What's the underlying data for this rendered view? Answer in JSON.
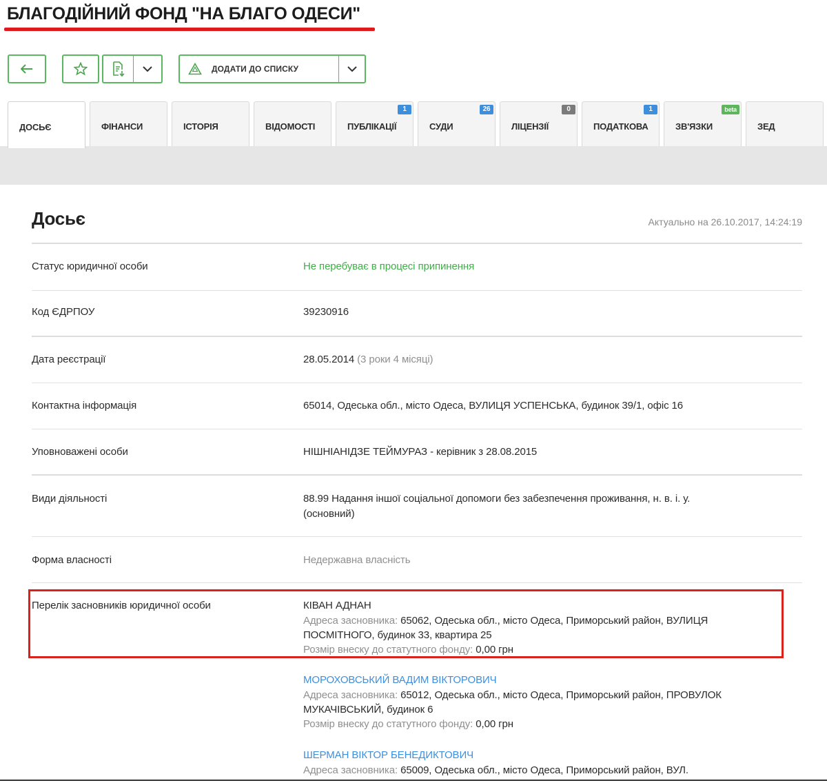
{
  "header": {
    "title": "БЛАГОДІЙНИЙ ФОНД \"НА БЛАГО ОДЕСИ\""
  },
  "toolbar": {
    "add_to_list_label": "ДОДАТИ ДО СПИСКУ",
    "icons": [
      "arrow-left-icon",
      "star-icon",
      "export-icon",
      "chevron-down-icon",
      "warning-triangle-icon"
    ]
  },
  "tabs": [
    {
      "label": "ДОСЬЄ",
      "badge": "",
      "active": true
    },
    {
      "label": "ФІНАНСИ",
      "badge": ""
    },
    {
      "label": "ІСТОРІЯ",
      "badge": ""
    },
    {
      "label": "ВІДОМОСТІ",
      "badge": ""
    },
    {
      "label": "ПУБЛІКАЦІЇ",
      "badge": "1"
    },
    {
      "label": "СУДИ",
      "badge": "26"
    },
    {
      "label": "ЛІЦЕНЗІЇ",
      "badge": "0"
    },
    {
      "label": "ПОДАТКОВА",
      "badge": "1"
    },
    {
      "label": "ЗВ'ЯЗКИ",
      "badge": "beta"
    },
    {
      "label": "ЗЕД",
      "badge": ""
    }
  ],
  "dossier": {
    "title": "Досьє",
    "updated": "Актуально на 26.10.2017, 14:24:19",
    "rows": [
      {
        "label": "Статус юридичної особи",
        "value": "Не перебуває в процесі припинення"
      },
      {
        "label": "Код ЄДРПОУ",
        "value": "39230916"
      },
      {
        "label": "Дата реєстрації",
        "value": "28.05.2014",
        "note": "(3 роки 4 місяці)"
      },
      {
        "label": "Контактна інформація",
        "value": "65014, Одеська обл., місто Одеса, ВУЛИЦЯ УСПЕНСЬКА, будинок 39/1, офіс 16"
      },
      {
        "label": "Уповноважені особи",
        "value": "НІШНІАНІДЗЕ ТЕЙМУРАЗ - керівник з 28.08.2015"
      },
      {
        "label": "Види діяльності",
        "value": "88.99 Надання іншої соціальної допомоги без забезпечення проживання, н. в. і. у.",
        "value2": "(основний)"
      },
      {
        "label": "Форма власності",
        "value": "Недержавна власність"
      },
      {
        "label": "Перелік засновників юридичної особи"
      }
    ]
  },
  "founders": [
    {
      "name": "КІВАН АДНАН",
      "address_key": "Адреса засновника:",
      "address": " 65062, Одеська обл., місто Одеса, Приморський район, ВУЛИЦЯ",
      "address2": "ПОСМІТНОГО, будинок 33, квартира 25",
      "capital_key": "Розмір внеску до статутного фонду:",
      "capital": " 0,00 грн"
    },
    {
      "name": "МОРОХОВСЬКИЙ ВАДИМ ВІКТОРОВИЧ",
      "address_key": "Адреса засновника:",
      "address": " 65012, Одеська обл., місто Одеса, Приморський район, ПРОВУЛОК",
      "address2": "МУКАЧІВСЬКИЙ, будинок 6",
      "capital_key": "Розмір внеску до статутного фонду:",
      "capital": " 0,00 грн"
    },
    {
      "name": "ШЕРМАН ВІКТОР БЕНЕДИКТОВИЧ",
      "address_key": "Адреса засновника:",
      "address": " 65009, Одеська обл., місто Одеса, Приморський район, ВУЛ."
    }
  ],
  "colors": {
    "accent_green": "#41ad49",
    "link_blue": "#3d8fde",
    "highlight_red": "#d9221c"
  }
}
